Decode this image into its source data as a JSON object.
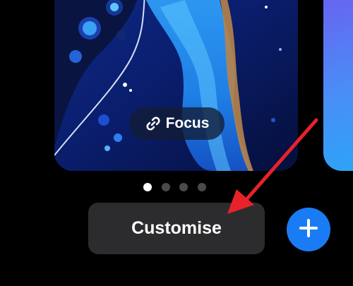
{
  "focus": {
    "label": "Focus",
    "icon": "link-icon"
  },
  "page_indicator": {
    "count": 4,
    "active_index": 0
  },
  "actions": {
    "customise_label": "Customise",
    "add_icon": "plus-icon"
  },
  "colors": {
    "background": "#000000",
    "customise_button": "#2c2c2e",
    "add_button": "#1a7cf5",
    "annotation_arrow": "#e8222a"
  }
}
